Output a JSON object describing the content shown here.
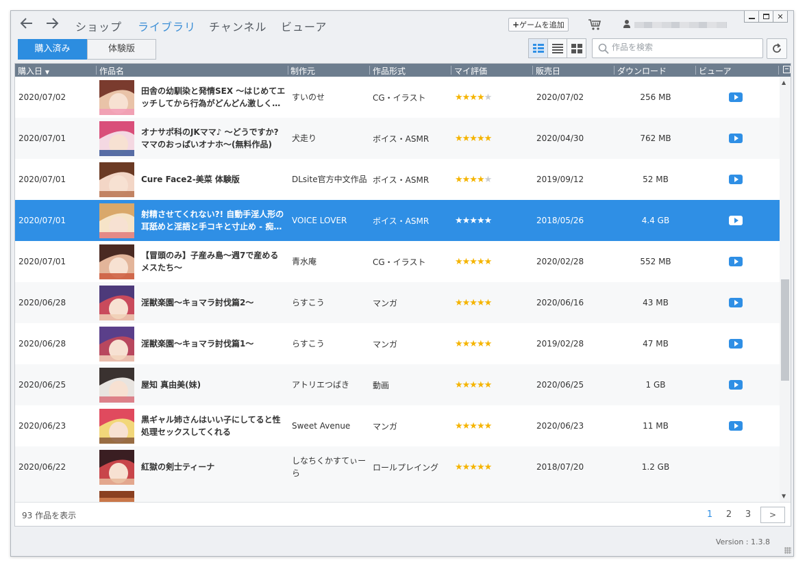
{
  "nav": {
    "back_icon": "arrow-left-icon",
    "forward_icon": "arrow-right-icon",
    "items": [
      {
        "label": "ショップ",
        "active": false
      },
      {
        "label": "ライブラリ",
        "active": true
      },
      {
        "label": "チャンネル",
        "active": false
      },
      {
        "label": "ビューア",
        "active": false
      }
    ]
  },
  "toolbar": {
    "add_game_plus": "+",
    "add_game_label": "ゲームを追加",
    "cart_icon": "cart-icon",
    "user_icon": "user-icon"
  },
  "tabs": [
    {
      "label": "購入済み",
      "active": true
    },
    {
      "label": "体験版",
      "active": false
    }
  ],
  "view_modes": [
    "detail-list-icon",
    "list-icon",
    "grid-icon"
  ],
  "search": {
    "placeholder": "作品を検索"
  },
  "columns": {
    "purchase_date": "購入日",
    "title": "作品名",
    "maker": "制作元",
    "format": "作品形式",
    "rating": "マイ評価",
    "release": "販売日",
    "download": "ダウンロード",
    "viewer": "ビューア"
  },
  "rows": [
    {
      "date": "2020/07/02",
      "title": "田舎の幼馴染と発情SEX ～はじめてエッチしてから行為がどんどん激しく…",
      "maker": "すいのせ",
      "format": "CG・イラスト",
      "rating": 4,
      "release": "2020/07/02",
      "size": "256 MB",
      "viewer": true,
      "selected": false,
      "thumb": [
        "#e9c3a8",
        "#7a3b2e",
        "#f29bb6"
      ]
    },
    {
      "date": "2020/07/01",
      "title": "オナサポ科のJKママ♪ ～どうですか? ママのおっぱいオナホ～(無料作品)",
      "maker": "犬走り",
      "format": "ボイス・ASMR",
      "rating": 5,
      "release": "2020/04/30",
      "size": "762 MB",
      "viewer": true,
      "selected": false,
      "thumb": [
        "#f4d8e2",
        "#d94f7a",
        "#3c5a9a"
      ]
    },
    {
      "date": "2020/07/01",
      "title": "Cure Face2-美菜 体験版",
      "maker": "DLsite官方中文作品",
      "format": "ボイス・ASMR",
      "rating": 4,
      "release": "2019/09/12",
      "size": "52 MB",
      "viewer": true,
      "selected": false,
      "thumb": [
        "#f3d6c6",
        "#6b3a24",
        "#b97451"
      ]
    },
    {
      "date": "2020/07/01",
      "title": "射精させてくれない?! 自動手淫人形の耳舐めと淫語と手コキと寸止め - 痴…",
      "maker": "VOICE LOVER",
      "format": "ボイス・ASMR",
      "rating": 5,
      "release": "2018/05/26",
      "size": "4.4 GB",
      "viewer": true,
      "selected": true,
      "thumb": [
        "#f6e4c8",
        "#d9a86a",
        "#e07a7a"
      ]
    },
    {
      "date": "2020/07/01",
      "title": "【冒頭のみ】子産み島～週7で産めるメスたち～",
      "maker": "青水庵",
      "format": "CG・イラスト",
      "rating": 5,
      "release": "2020/02/28",
      "size": "552 MB",
      "viewer": true,
      "selected": false,
      "thumb": [
        "#e3b59a",
        "#4a2a22",
        "#cc5a3d"
      ]
    },
    {
      "date": "2020/06/28",
      "title": "淫獣楽園～キョマラ討伐篇2～",
      "maker": "らすこう",
      "format": "マンガ",
      "rating": 5,
      "release": "2020/06/16",
      "size": "43 MB",
      "viewer": true,
      "selected": false,
      "thumb": [
        "#c94a5c",
        "#4d3a7a",
        "#f0cfb5"
      ]
    },
    {
      "date": "2020/06/28",
      "title": "淫獣楽園～キョマラ討伐篇1～",
      "maker": "らすこう",
      "format": "マンガ",
      "rating": 5,
      "release": "2019/02/28",
      "size": "47 MB",
      "viewer": true,
      "selected": false,
      "thumb": [
        "#b8475e",
        "#5a3f8a",
        "#f2d2bb"
      ]
    },
    {
      "date": "2020/06/25",
      "title": "屋知 真由美(妹)",
      "maker": "アトリエつばき",
      "format": "動画",
      "rating": 5,
      "release": "2020/06/25",
      "size": "1 GB",
      "viewer": true,
      "selected": false,
      "thumb": [
        "#e8e4e0",
        "#3a3230",
        "#d9707a"
      ]
    },
    {
      "date": "2020/06/23",
      "title": "黒ギャル姉さんはいい子にしてると性処理セックスしてくれる",
      "maker": "Sweet Avenue",
      "format": "マンガ",
      "rating": 5,
      "release": "2020/06/23",
      "size": "11 MB",
      "viewer": true,
      "selected": false,
      "thumb": [
        "#f2d77a",
        "#e04a5e",
        "#8a5a3a"
      ]
    },
    {
      "date": "2020/06/22",
      "title": "紅獄の剣士ティーナ",
      "maker": "しなちくかすてぃーら",
      "format": "ロールプレイング",
      "rating": 5,
      "release": "2018/07/20",
      "size": "1.2 GB",
      "viewer": false,
      "selected": false,
      "thumb": [
        "#c8454a",
        "#3a1e22",
        "#e8b89a"
      ]
    }
  ],
  "footer": {
    "count_label": "93 作品を表示",
    "pages": [
      "1",
      "2",
      "3"
    ],
    "active_page": "1",
    "next_label": ">"
  },
  "version": "Version : 1.3.8",
  "colors": {
    "accent": "#2f8fe5",
    "header_bg": "#6d7d8e",
    "star": "#f5b400",
    "nav_active": "#3d8fd6"
  }
}
